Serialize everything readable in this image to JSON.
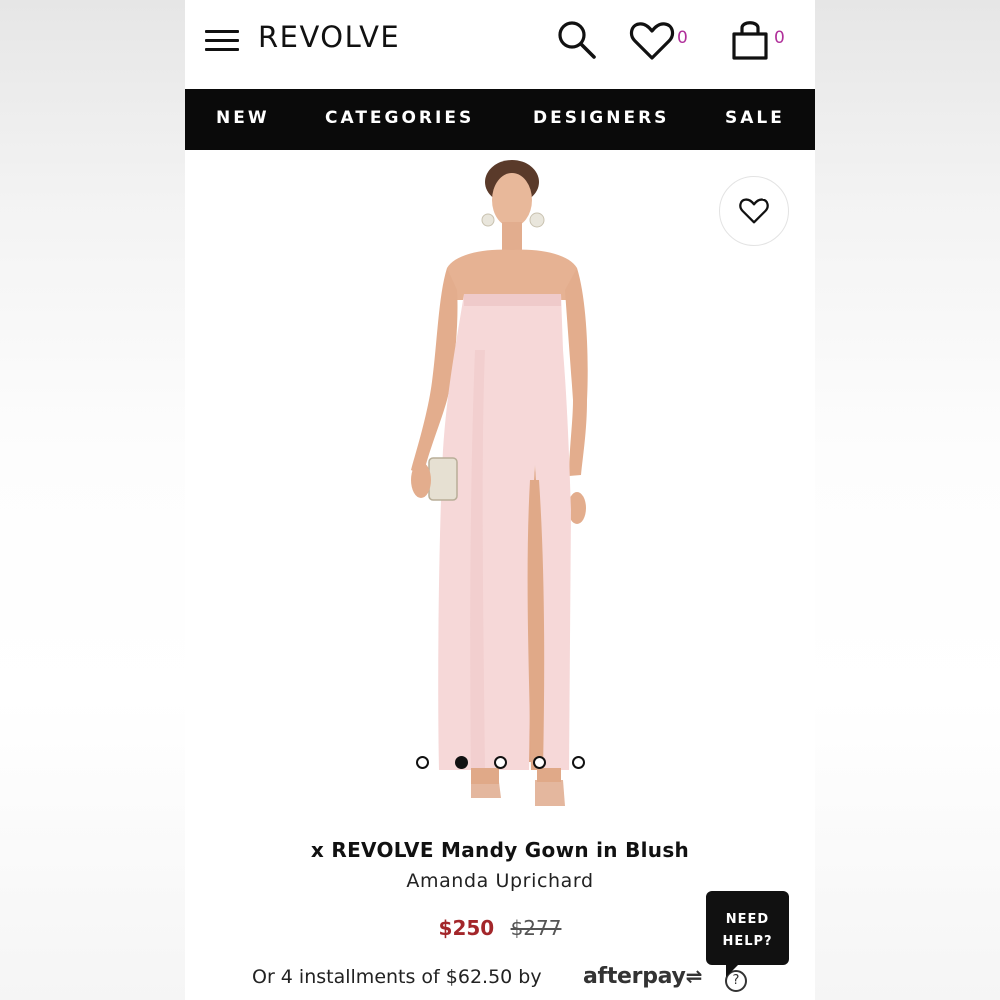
{
  "header": {
    "brand": "REVOLVE",
    "wishlist_count": "0",
    "bag_count": "0",
    "count_color": "#b0309a"
  },
  "nav": {
    "items": [
      {
        "label": "NEW"
      },
      {
        "label": "CATEGORIES"
      },
      {
        "label": "DESIGNERS"
      },
      {
        "label": "SALE"
      }
    ]
  },
  "gallery": {
    "image_count": 5,
    "active_index": 1
  },
  "product": {
    "title": "x REVOLVE Mandy Gown in Blush",
    "designer": "Amanda Uprichard",
    "price": "$250",
    "original_price": "$277",
    "installments_text": "Or 4 installments of $62.50 by",
    "payment_provider": "afterpay",
    "help_icon": "?"
  },
  "help_widget": {
    "line1": "NEED",
    "line2": "HELP?"
  },
  "colors": {
    "nav_bg": "#0a0a0a",
    "sale_price": "#a3262a",
    "dress_blush": "#f6d8d8"
  }
}
